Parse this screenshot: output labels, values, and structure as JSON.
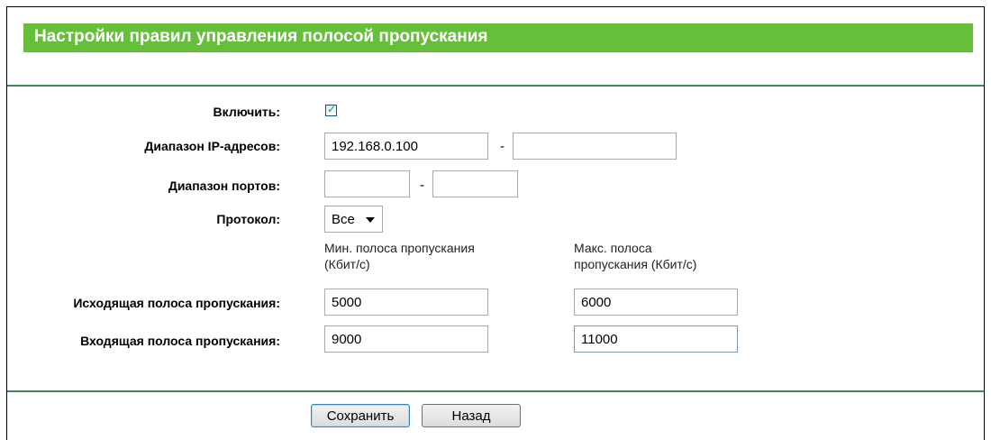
{
  "page": {
    "title": "Настройки правил управления полосой пропускания"
  },
  "form": {
    "enable_label": "Включить:",
    "enable_checked": true,
    "ip_range_label": "Диапазон IP-адресов:",
    "ip_start_value": "192.168.0.100",
    "ip_end_value": "",
    "port_range_label": "Диапазон портов:",
    "port_start_value": "",
    "port_end_value": "",
    "range_separator": "-",
    "protocol_label": "Протокол:",
    "protocol_selected": "Все",
    "min_bandwidth_header_line1": "Мин. полоса пропускания",
    "min_bandwidth_header_line2": "(Кбит/с)",
    "max_bandwidth_header_line1": "Макс. полоса",
    "max_bandwidth_header_line2": "пропускания (Кбит/с)",
    "egress_label": "Исходящая полоса пропускания:",
    "egress_min_value": "5000",
    "egress_max_value": "6000",
    "ingress_label": "Входящая полоса пропускания:",
    "ingress_min_value": "9000",
    "ingress_max_value": "11000"
  },
  "buttons": {
    "save_label": "Сохранить",
    "back_label": "Назад"
  },
  "colors": {
    "title_bar": "#66bf3b",
    "rule": "#3d8a5a"
  }
}
